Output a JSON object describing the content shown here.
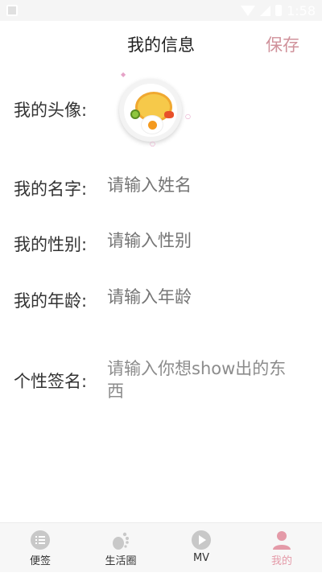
{
  "status_bar": {
    "time": "1:58"
  },
  "header": {
    "title": "我的信息",
    "save_label": "保存"
  },
  "form": {
    "avatar_label": "我的头像:",
    "name_label": "我的名字:",
    "name_placeholder": "请输入姓名",
    "gender_label": "我的性别:",
    "gender_placeholder": "请输入性别",
    "age_label": "我的年龄:",
    "age_placeholder": "请输入年龄",
    "signature_label": "个性签名:",
    "signature_placeholder_line1": "请输入你想show出的东",
    "signature_placeholder_line2": "西"
  },
  "tabs": [
    {
      "label": "便签",
      "icon": "list-icon",
      "active": false
    },
    {
      "label": "生活圈",
      "icon": "footprint-icon",
      "active": false
    },
    {
      "label": "MV",
      "icon": "play-icon",
      "active": false
    },
    {
      "label": "我的",
      "icon": "person-icon",
      "active": true
    }
  ],
  "colors": {
    "accent": "#e49aa8",
    "save": "#d0929b",
    "placeholder": "#8c8c8c"
  }
}
